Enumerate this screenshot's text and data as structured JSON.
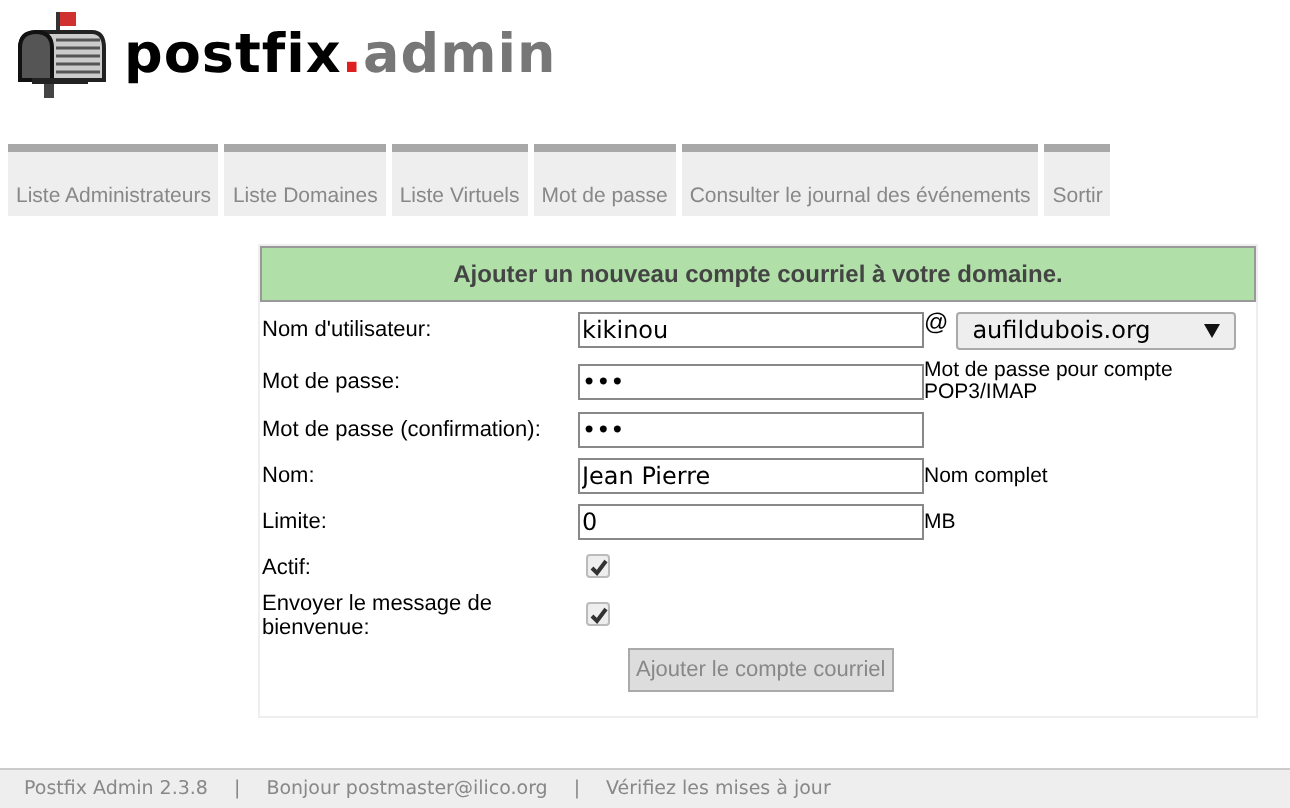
{
  "logo": {
    "parts": [
      {
        "text": "postfix",
        "color": "#000000"
      },
      {
        "text": ".",
        "color": "#e02020"
      },
      {
        "text": "admin",
        "color": "#777777"
      }
    ]
  },
  "tabs": [
    {
      "label": "Liste Administrateurs",
      "selected": false
    },
    {
      "label": "Liste Domaines",
      "selected": false
    },
    {
      "label": "Liste Virtuels",
      "selected": false
    },
    {
      "label": "Mot de passe",
      "selected": false
    },
    {
      "label": "Consulter le journal des événements",
      "selected": false
    },
    {
      "label": "Sortir",
      "selected": false
    }
  ],
  "form": {
    "title": "Ajouter un nouveau compte courriel à votre domaine.",
    "rows": [
      {
        "kind": "text",
        "label": "Nom d'utilisateur:",
        "value": "kikinou",
        "suffix": "@",
        "select": "aufildubois.org"
      },
      {
        "kind": "text",
        "label": "Mot de passe:",
        "value": "•••",
        "help": "Mot de passe pour compte POP3/IMAP"
      },
      {
        "kind": "text",
        "label": "Mot de passe (confirmation):",
        "value": "•••"
      },
      {
        "kind": "text",
        "label": "Nom:",
        "value": "Jean Pierre",
        "help": "Nom complet"
      },
      {
        "kind": "text",
        "label": "Limite:",
        "value": "0",
        "help": "MB"
      },
      {
        "kind": "checkbox",
        "label": "Actif:",
        "checked": true
      },
      {
        "kind": "checkbox",
        "label": "Envoyer le message de bienvenue:",
        "checked": true
      }
    ],
    "submit": "Ajouter le compte courriel"
  },
  "footer": {
    "separator": "|",
    "items": [
      "Postfix Admin 2.3.8",
      "Bonjour postmaster@ilico.org",
      "Vérifiez les mises à jour"
    ]
  }
}
